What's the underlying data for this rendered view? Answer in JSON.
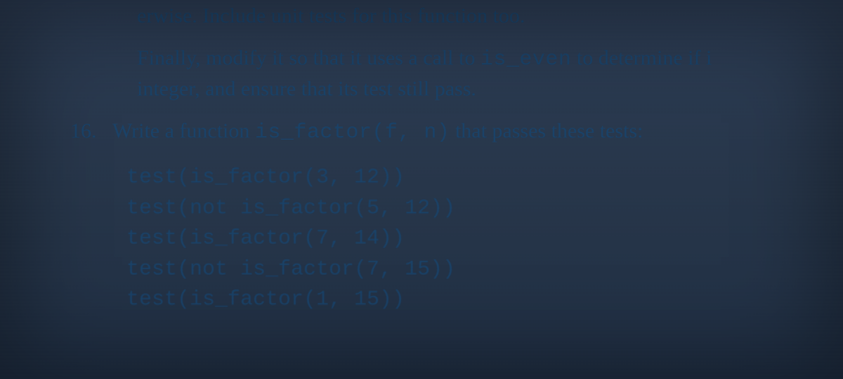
{
  "para_fragment": "erwise. Include unit tests for this function too.",
  "para_final_1": "Finally, modify it so that it uses a call to ",
  "para_final_code": "is_even",
  "para_final_2": " to determine if i",
  "para_final_line2": "integer, and ensure that its test still pass.",
  "item_number": "16.",
  "item_text_1": "Write a function ",
  "item_code": "is_factor(f, n)",
  "item_text_2": " that passes these tests:",
  "tests": [
    "test(is_factor(3, 12))",
    "test(not is_factor(5, 12))",
    "test(is_factor(7, 14))",
    "test(not is_factor(7, 15))",
    "test(is_factor(1, 15))"
  ]
}
